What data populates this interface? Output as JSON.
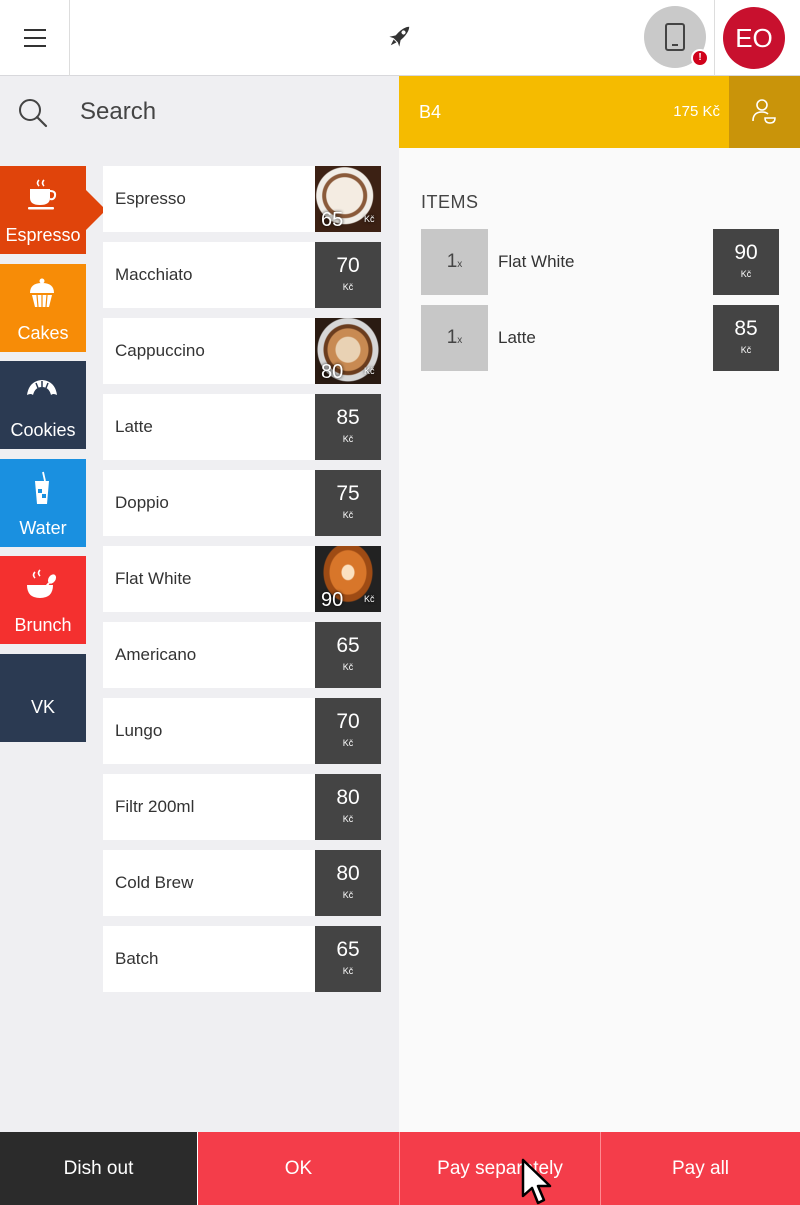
{
  "header": {
    "menu_icon": "hamburger-menu-icon",
    "center_icon": "rocket-icon",
    "device_icon": "tablet-icon",
    "device_alert": "!",
    "user_initials": "EO"
  },
  "search": {
    "placeholder": "Search"
  },
  "categories": [
    {
      "label": "Espresso",
      "icon": "coffee-cup-icon",
      "color": "#e0440b",
      "active": true
    },
    {
      "label": "Cakes",
      "icon": "cupcake-icon",
      "color": "#f78c07"
    },
    {
      "label": "Cookies",
      "icon": "croissant-icon",
      "color": "#2b3a52"
    },
    {
      "label": "Water",
      "icon": "iced-drink-icon",
      "color": "#1a90e0"
    },
    {
      "label": "Brunch",
      "icon": "bowl-spoon-icon",
      "color": "#f4302f"
    },
    {
      "label": "VK",
      "icon": "",
      "color": "#2b3a52"
    }
  ],
  "products": [
    {
      "name": "Espresso",
      "price": "65",
      "currency": "Kč",
      "has_photo": true
    },
    {
      "name": "Macchiato",
      "price": "70",
      "currency": "Kč"
    },
    {
      "name": "Cappuccino",
      "price": "80",
      "currency": "Kč",
      "has_photo": true
    },
    {
      "name": "Latte",
      "price": "85",
      "currency": "Kč"
    },
    {
      "name": "Doppio",
      "price": "75",
      "currency": "Kč"
    },
    {
      "name": "Flat White",
      "price": "90",
      "currency": "Kč",
      "has_photo": true
    },
    {
      "name": "Americano",
      "price": "65",
      "currency": "Kč"
    },
    {
      "name": "Lungo",
      "price": "70",
      "currency": "Kč"
    },
    {
      "name": "Filtr 200ml",
      "price": "80",
      "currency": "Kč"
    },
    {
      "name": "Cold Brew",
      "price": "80",
      "currency": "Kč"
    },
    {
      "name": "Batch",
      "price": "65",
      "currency": "Kč"
    }
  ],
  "order": {
    "table": "B4",
    "total": "175 Kč",
    "guest_icon": "guest-person-icon",
    "items_title": "ITEMS",
    "items": [
      {
        "qty": "1",
        "qty_suffix": "x",
        "name": "Flat White",
        "price": "90",
        "currency": "Kč"
      },
      {
        "qty": "1",
        "qty_suffix": "x",
        "name": "Latte",
        "price": "85",
        "currency": "Kč"
      }
    ]
  },
  "actions": {
    "dish_out": "Dish out",
    "ok": "OK",
    "pay_separately": "Pay separately",
    "pay_all": "Pay all"
  },
  "colors": {
    "order_header": "#f5bb00",
    "action_red": "#f43d4a",
    "price_box": "#444444",
    "avatar": "#c8102e"
  }
}
